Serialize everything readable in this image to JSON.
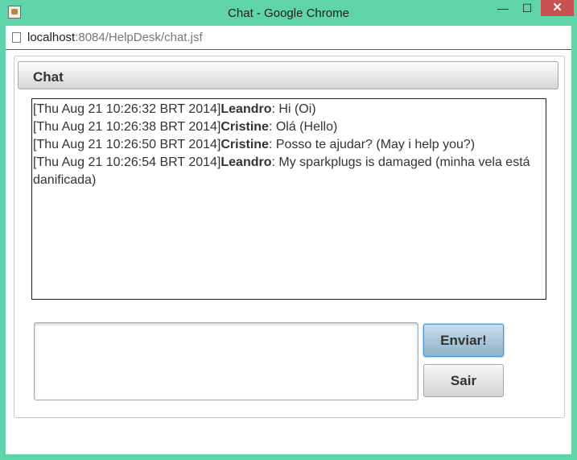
{
  "window": {
    "title": "Chat - Google Chrome",
    "minimize": "—",
    "maximize": "☐",
    "close": "✕"
  },
  "address": {
    "host": "localhost",
    "path": ":8084/HelpDesk/chat.jsf"
  },
  "panel": {
    "title": "Chat"
  },
  "messages": [
    {
      "time": "[Thu Aug 21 10:26:32 BRT 2014]",
      "user": "Leandro",
      "text": ": Hi (Oi)"
    },
    {
      "time": "[Thu Aug 21 10:26:38 BRT 2014]",
      "user": "Cristine",
      "text": ": Olá (Hello)"
    },
    {
      "time": "[Thu Aug 21 10:26:50 BRT 2014]",
      "user": "Cristine",
      "text": ": Posso te ajudar? (May i help you?)"
    },
    {
      "time": "[Thu Aug 21 10:26:54 BRT 2014]",
      "user": "Leandro",
      "text": ": My sparkplugs is damaged (minha vela está danificada)"
    }
  ],
  "input": {
    "value": ""
  },
  "buttons": {
    "send": "Enviar!",
    "exit": "Sair"
  }
}
